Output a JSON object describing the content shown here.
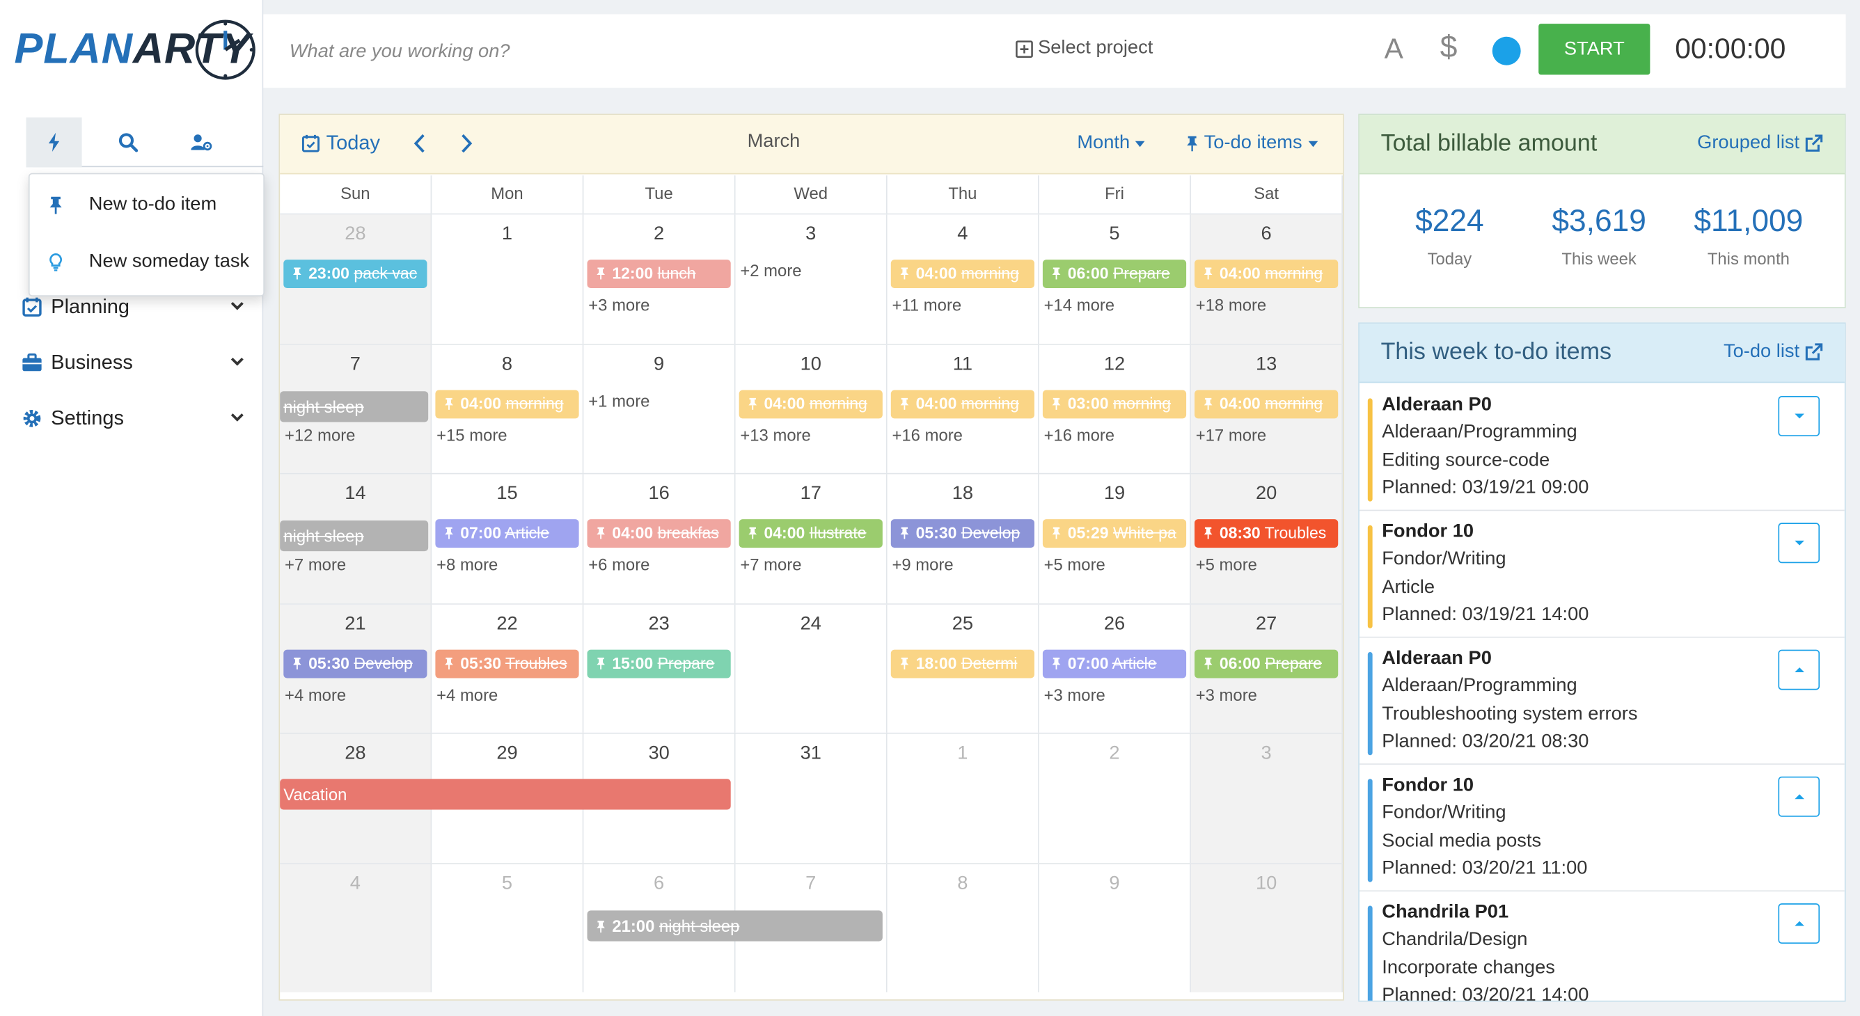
{
  "app": {
    "logo_plan": "PLAN",
    "logo_arty": "ARTY"
  },
  "topbar": {
    "work_placeholder": "What are you working on?",
    "select_project": "Select project",
    "a_label": "A",
    "dollar_label": "$",
    "start_label": "START",
    "timer": "00:00:00",
    "dot_color": "#1ba1e8"
  },
  "quick_menu": {
    "items": [
      {
        "label": "New to-do item",
        "icon": "pin-icon"
      },
      {
        "label": "New someday task",
        "icon": "lightbulb-icon"
      }
    ]
  },
  "sidebar": {
    "tabs": [
      "bolt-icon",
      "search-icon",
      "user-gear-icon"
    ],
    "items": [
      {
        "label": "Planning",
        "icon": "calendar-check-icon"
      },
      {
        "label": "Business",
        "icon": "briefcase-icon"
      },
      {
        "label": "Settings",
        "icon": "gear-icon"
      }
    ]
  },
  "calendar": {
    "today_label": "Today",
    "month_title": "March",
    "view_label": "Month",
    "filter_label": "To-do items",
    "weekdays": [
      "Sun",
      "Mon",
      "Tue",
      "Wed",
      "Thu",
      "Fri",
      "Sat"
    ],
    "weeks": [
      [
        {
          "d": "28",
          "other": true,
          "ev": {
            "time": "23:00",
            "title": "pack vac",
            "color": "#5bc0de",
            "strike": true
          }
        },
        {
          "d": "1"
        },
        {
          "d": "2",
          "ev": {
            "time": "12:00",
            "title": "lunch",
            "color": "#f0a6a0",
            "strike": true
          },
          "more": "+3 more"
        },
        {
          "d": "3",
          "more": "+2 more"
        },
        {
          "d": "4",
          "ev": {
            "time": "04:00",
            "title": "morning",
            "color": "#fad586",
            "strike": true
          },
          "more": "+11 more"
        },
        {
          "d": "5",
          "ev": {
            "time": "06:00",
            "title": "Prepare",
            "color": "#9bcc6e",
            "strike": true
          },
          "more": "+14 more"
        },
        {
          "d": "6",
          "ev": {
            "time": "04:00",
            "title": "morning",
            "color": "#fad586",
            "strike": true
          },
          "more": "+18 more"
        }
      ],
      [
        {
          "d": "7",
          "span": true,
          "more": "+12 more"
        },
        {
          "d": "8",
          "ev": {
            "time": "04:00",
            "title": "morning",
            "color": "#fad586",
            "strike": true
          },
          "more": "+15 more"
        },
        {
          "d": "9",
          "more": "+1 more"
        },
        {
          "d": "10",
          "ev": {
            "time": "04:00",
            "title": "morning",
            "color": "#fad586",
            "strike": true
          },
          "more": "+13 more"
        },
        {
          "d": "11",
          "ev": {
            "time": "04:00",
            "title": "morning",
            "color": "#fad586",
            "strike": true
          },
          "more": "+16 more"
        },
        {
          "d": "12",
          "ev": {
            "time": "03:00",
            "title": "morning",
            "color": "#fad586",
            "strike": true
          },
          "more": "+16 more"
        },
        {
          "d": "13",
          "ev": {
            "time": "04:00",
            "title": "morning",
            "color": "#fad586",
            "strike": true
          },
          "more": "+17 more"
        }
      ],
      [
        {
          "d": "14",
          "span": true,
          "more": "+7 more"
        },
        {
          "d": "15",
          "ev": {
            "time": "07:00",
            "title": "Article",
            "color": "#9fa4f0",
            "strike": true
          },
          "more": "+8 more"
        },
        {
          "d": "16",
          "ev": {
            "time": "04:00",
            "title": "breakfas",
            "color": "#f0a6a0",
            "strike": true
          },
          "more": "+6 more"
        },
        {
          "d": "17",
          "ev": {
            "time": "04:00",
            "title": "Ilustrate",
            "color": "#9bcc6e",
            "strike": true
          },
          "more": "+7 more"
        },
        {
          "d": "18",
          "ev": {
            "time": "05:30",
            "title": "Develop",
            "color": "#8c94d8",
            "strike": true
          },
          "more": "+9 more"
        },
        {
          "d": "19",
          "ev": {
            "time": "05:29",
            "title": "White pa",
            "color": "#fad586",
            "strike": true
          },
          "more": "+5 more"
        },
        {
          "d": "20",
          "ev": {
            "time": "08:30",
            "title": "Troubles",
            "color": "#f2542d",
            "strike": false
          },
          "more": "+5 more"
        }
      ],
      [
        {
          "d": "21",
          "ev": {
            "time": "05:30",
            "title": "Develop",
            "color": "#8c94d8",
            "strike": true
          },
          "more": "+4 more"
        },
        {
          "d": "22",
          "ev": {
            "time": "05:30",
            "title": "Troubles",
            "color": "#f39e7e",
            "strike": true
          },
          "more": "+4 more"
        },
        {
          "d": "23",
          "ev": {
            "time": "15:00",
            "title": "Prepare",
            "color": "#7fd3b0",
            "strike": true
          }
        },
        {
          "d": "24"
        },
        {
          "d": "25",
          "ev": {
            "time": "18:00",
            "title": "Determi",
            "color": "#fad586",
            "strike": true
          }
        },
        {
          "d": "26",
          "ev": {
            "time": "07:00",
            "title": "Article",
            "color": "#9fa4f0",
            "strike": true
          },
          "more": "+3 more"
        },
        {
          "d": "27",
          "ev": {
            "time": "06:00",
            "title": "Prepare",
            "color": "#9bcc6e",
            "strike": true
          },
          "more": "+3 more"
        }
      ],
      [
        {
          "d": "28"
        },
        {
          "d": "29"
        },
        {
          "d": "30"
        },
        {
          "d": "31"
        },
        {
          "d": "1",
          "other": true
        },
        {
          "d": "2",
          "other": true
        },
        {
          "d": "3",
          "other": true
        }
      ],
      [
        {
          "d": "4",
          "other": true
        },
        {
          "d": "5",
          "other": true
        },
        {
          "d": "6",
          "other": true
        },
        {
          "d": "7",
          "other": true
        },
        {
          "d": "8",
          "other": true
        },
        {
          "d": "9",
          "other": true
        },
        {
          "d": "10",
          "other": true
        }
      ]
    ],
    "night_sleep": {
      "title": "night sleep",
      "color": "#b3b3b3"
    },
    "night_sleep_2": {
      "time": "21:00",
      "title": "night sleep",
      "color": "#b3b3b3"
    },
    "vacation": {
      "title": "Vacation",
      "color": "#e8786f"
    }
  },
  "billable": {
    "title": "Total billable amount",
    "link": "Grouped list",
    "cols": [
      {
        "value": "$224",
        "label": "Today"
      },
      {
        "value": "$3,619",
        "label": "This week"
      },
      {
        "value": "$11,009",
        "label": "This month"
      }
    ]
  },
  "todos": {
    "title": "This week to-do items",
    "link": "To-do list",
    "items": [
      {
        "title": "Alderaan P0",
        "project": "Alderaan/Programming",
        "task": "Editing source-code",
        "planned": "Planned: 03/19/21 09:00",
        "color": "#f7c244",
        "expanded": false
      },
      {
        "title": "Fondor 10",
        "project": "Fondor/Writing",
        "task": "Article",
        "planned": "Planned: 03/19/21 14:00",
        "color": "#f7c244",
        "expanded": false
      },
      {
        "title": "Alderaan P0",
        "project": "Alderaan/Programming",
        "task": "Troubleshooting system errors",
        "planned": "Planned: 03/20/21 08:30",
        "color": "#4ba3e3",
        "expanded": true
      },
      {
        "title": "Fondor 10",
        "project": "Fondor/Writing",
        "task": "Social media posts",
        "planned": "Planned: 03/20/21 11:00",
        "color": "#4ba3e3",
        "expanded": true
      },
      {
        "title": "Chandrila P01",
        "project": "Chandrila/Design",
        "task": "Incorporate changes",
        "planned": "Planned: 03/20/21 14:00",
        "color": "#4ba3e3",
        "expanded": true
      }
    ]
  }
}
